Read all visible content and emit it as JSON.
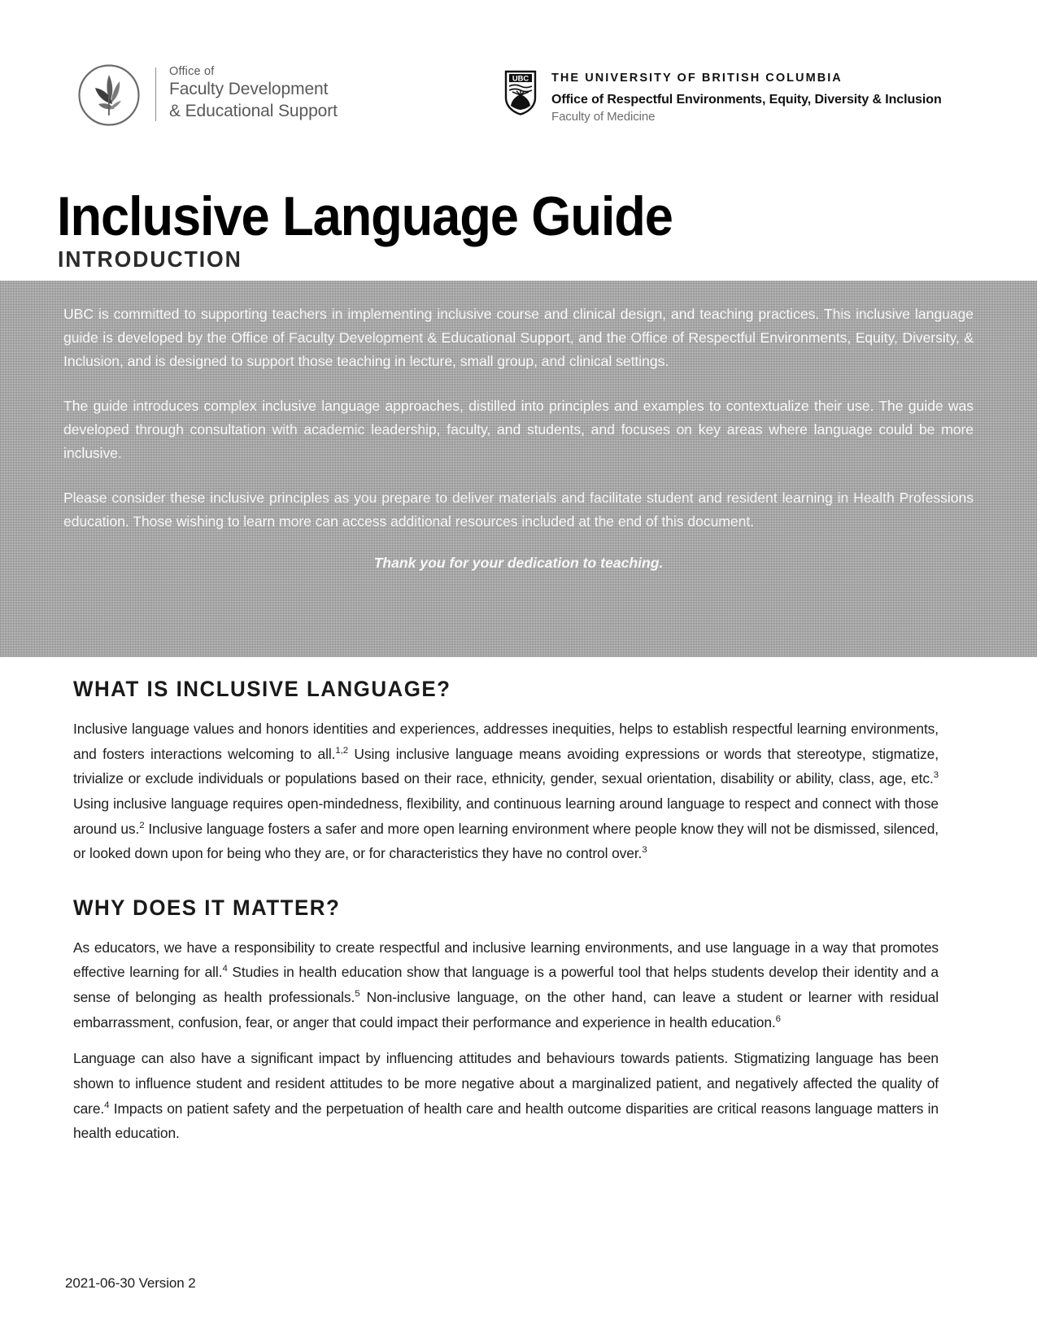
{
  "header": {
    "fdes": {
      "line1": "Office of",
      "line2": "Faculty Development",
      "line3": "& Educational Support",
      "logo_icon": "leaf-circle-emblem"
    },
    "ubc": {
      "crest_icon": "ubc-shield-crest",
      "crest_label": "UBC",
      "university": "THE UNIVERSITY OF BRITISH COLUMBIA",
      "office": "Office of Respectful Environments, Equity, Diversity & Inclusion",
      "faculty": "Faculty of Medicine"
    }
  },
  "title": "Inclusive Language Guide",
  "subtitle": "INTRODUCTION",
  "intro": {
    "paragraph1": "UBC is committed to supporting teachers in implementing inclusive course and clinical design, and teaching practices. This inclusive language guide is developed by the Office of Faculty Development & Educational Support, and the Office of Respectful Environments, Equity, Diversity, & Inclusion, and is designed to support those teaching in lecture, small group, and clinical settings.",
    "paragraph2": "The guide introduces complex inclusive language approaches, distilled into principles and examples to contextualize their use. The guide was developed through consultation with academic leadership, faculty, and students, and focuses on key areas where language could be more inclusive.",
    "paragraph3": "Please consider these inclusive principles as you prepare to deliver materials and facilitate student and resident learning in Health Professions education. Those wishing to learn more can access additional resources included at the end of this document.",
    "thanks": "Thank you for your dedication to teaching."
  },
  "sections": [
    {
      "heading": "WHAT IS INCLUSIVE LANGUAGE?",
      "paragraphs": [
        {
          "runs": [
            {
              "text": "Inclusive language values and honors identities and experiences, addresses inequities, helps to establish respectful learning environments, and fosters interactions welcoming to all."
            },
            {
              "text": "1,2",
              "sup": true
            },
            {
              "text": " Using inclusive language means avoiding expressions or words that stereotype, stigmatize, trivialize or exclude individuals or populations based on their race, ethnicity, gender, sexual orientation, disability or ability, class, age, etc."
            },
            {
              "text": "3",
              "sup": true
            },
            {
              "text": " Using inclusive language requires open-mindedness, flexibility, and continuous learning around language to respect and connect with those around us."
            },
            {
              "text": "2",
              "sup": true
            },
            {
              "text": " Inclusive language fosters a safer and more open learning environment where people know they will not be dismissed, silenced, or looked down upon for being who they are, or for characteristics they have no control over."
            },
            {
              "text": "3",
              "sup": true
            }
          ]
        }
      ]
    },
    {
      "heading": "WHY DOES IT MATTER?",
      "paragraphs": [
        {
          "runs": [
            {
              "text": "As educators, we have a responsibility to create respectful and inclusive learning environments, and use language in a way that promotes effective learning for all."
            },
            {
              "text": "4",
              "sup": true
            },
            {
              "text": " Studies in health education show that language is a powerful tool that helps students develop their identity and a sense of belonging as health professionals."
            },
            {
              "text": "5",
              "sup": true
            },
            {
              "text": " Non-inclusive language, on the other hand, can leave a student or learner with residual embarrassment, confusion, fear, or anger that could impact their performance and experience in health education."
            },
            {
              "text": "6",
              "sup": true
            }
          ]
        },
        {
          "runs": [
            {
              "text": "Language can also have a significant impact by influencing attitudes and behaviours towards patients. Stigmatizing language has been shown to influence student and resident attitudes to be more negative about a marginalized patient, and negatively affected the quality of care."
            },
            {
              "text": "4",
              "sup": true
            },
            {
              "text": " Impacts on patient safety and the perpetuation of health care and health outcome disparities are critical reasons language matters in health education."
            }
          ]
        }
      ]
    }
  ],
  "footer": "2021-06-30 Version 2",
  "colors": {
    "intro_box_background": "#9d9d9d",
    "intro_text": "#ffffff",
    "body_text": "#1d1d1d",
    "fdes_text": "#595959"
  }
}
